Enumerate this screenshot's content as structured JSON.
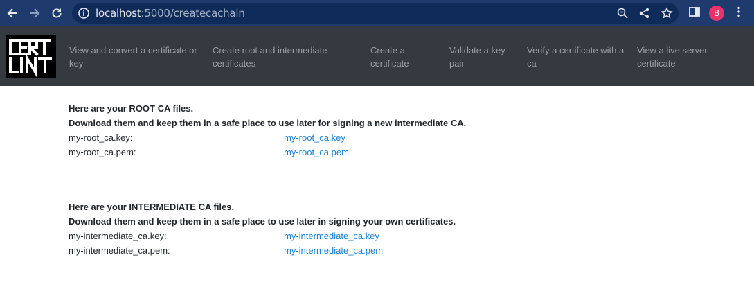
{
  "browser": {
    "url_host": "localhost",
    "url_path": ":5000/createcachain",
    "avatar_letter": "B"
  },
  "navbar": {
    "logo_text": "CERT LINT",
    "items": [
      {
        "label": "View and convert a certificate or key"
      },
      {
        "label": "Create root and intermediate certificates"
      },
      {
        "label": "Create a certificate"
      },
      {
        "label": "Validate a key pair"
      },
      {
        "label": "Verify a certificate with a ca"
      },
      {
        "label": "View a live server certificate"
      }
    ]
  },
  "root": {
    "title": "Here are your ROOT CA files.",
    "subtitle": "Download them and keep them in a safe place to use later for signing a new intermediate CA.",
    "files": [
      {
        "label": "my-root_ca.key:",
        "link": "my-root_ca.key"
      },
      {
        "label": "my-root_ca.pem:",
        "link": "my-root_ca.pem"
      }
    ]
  },
  "intermediate": {
    "title": "Here are your INTERMEDIATE CA files.",
    "subtitle": "Download them and keep them in a safe place to use later in signing your own certificates.",
    "files": [
      {
        "label": "my-intermediate_ca.key:",
        "link": "my-intermediate_ca.key"
      },
      {
        "label": "my-intermediate_ca.pem:",
        "link": "my-intermediate_ca.pem"
      }
    ]
  },
  "colors": {
    "chrome": "#1f3b6e",
    "navbar": "#343a40",
    "link": "#1a7fd6",
    "avatar": "#e8336b"
  }
}
